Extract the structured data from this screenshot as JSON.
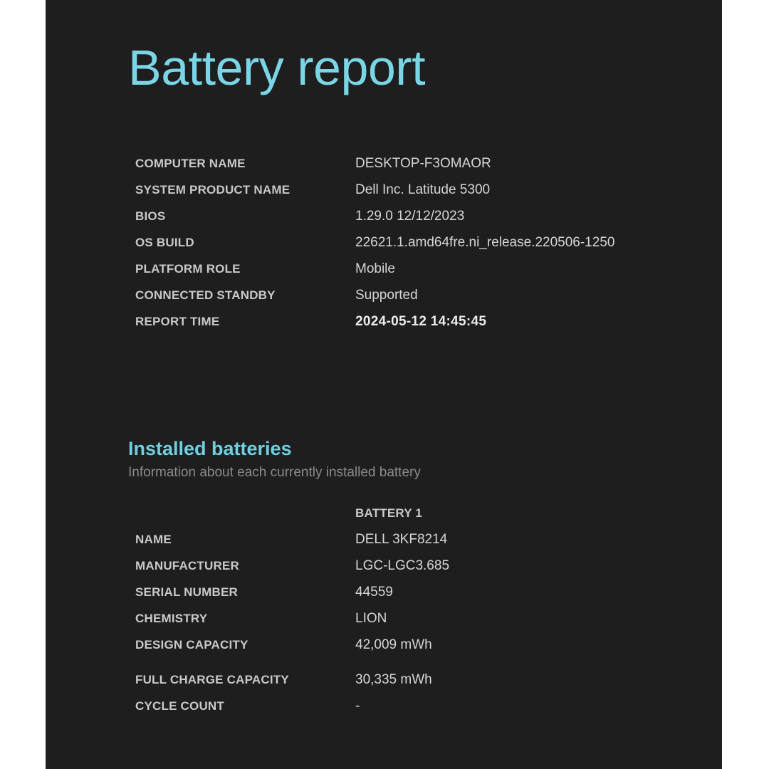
{
  "report": {
    "title": "Battery report"
  },
  "system": {
    "rows": [
      {
        "label": "COMPUTER NAME",
        "value": "DESKTOP-F3OMAOR"
      },
      {
        "label": "SYSTEM PRODUCT NAME",
        "value": "Dell Inc. Latitude 5300"
      },
      {
        "label": "BIOS",
        "value": "1.29.0 12/12/2023"
      },
      {
        "label": "OS BUILD",
        "value": "22621.1.amd64fre.ni_release.220506-1250"
      },
      {
        "label": "PLATFORM ROLE",
        "value": "Mobile"
      },
      {
        "label": "CONNECTED STANDBY",
        "value": "Supported"
      },
      {
        "label": "REPORT TIME",
        "value": "2024-05-12  14:45:45"
      }
    ]
  },
  "installed_batteries": {
    "heading": "Installed batteries",
    "subtitle": "Information about each currently installed battery",
    "column_header": "BATTERY 1",
    "rows": [
      {
        "label": "NAME",
        "value": "DELL 3KF8214"
      },
      {
        "label": "MANUFACTURER",
        "value": "LGC-LGC3.685"
      },
      {
        "label": "SERIAL NUMBER",
        "value": "44559"
      },
      {
        "label": "CHEMISTRY",
        "value": "LION"
      },
      {
        "label": "DESIGN CAPACITY",
        "value": "42,009 mWh"
      },
      {
        "label": "FULL CHARGE CAPACITY",
        "value": "30,335 mWh"
      },
      {
        "label": "CYCLE COUNT",
        "value": "-"
      }
    ]
  },
  "colors": {
    "page_background": "#1e1e1e",
    "outer_background": "#ffffff",
    "accent_cyan": "#7ad5e6",
    "heading_cyan": "#6fd0e2",
    "label_gray": "#c9c9c9",
    "value_gray": "#d6d6d6",
    "subtitle_gray": "#8b8b8b"
  }
}
